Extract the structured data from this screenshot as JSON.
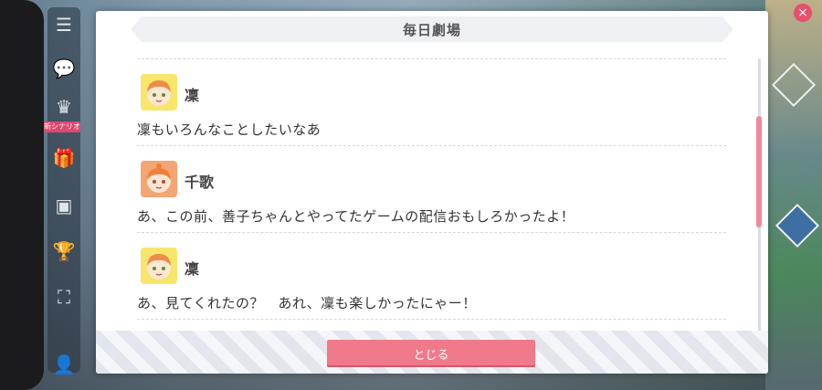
{
  "window": {
    "title": "毎日劇場"
  },
  "side_menu": {
    "tag_label": "新シナリオ",
    "items": [
      {
        "icon": "menu-icon"
      },
      {
        "icon": "chat-icon"
      },
      {
        "icon": "crown-icon"
      },
      {
        "icon": "gift-icon"
      },
      {
        "icon": "screen-icon"
      },
      {
        "icon": "trophy-icon"
      },
      {
        "icon": "fullscreen-icon"
      }
    ]
  },
  "entries": [
    {
      "speaker": "凜",
      "text": "凜もいろんなことしたいなあ",
      "avatar_color": "#f7e66b",
      "hair_color": "#ee8a4a"
    },
    {
      "speaker": "千歌",
      "text": "あ、この前、善子ちゃんとやってたゲームの配信おもしろかったよ！",
      "avatar_color": "#f4a574",
      "hair_color": "#ef7f3a"
    },
    {
      "speaker": "凜",
      "text": "あ、見てくれたの？　あれ、凜も楽しかったにゃー！",
      "avatar_color": "#f7e66b",
      "hair_color": "#ee8a4a"
    }
  ],
  "footer": {
    "close_label": "とじる"
  },
  "colors": {
    "accent": "#f07a8b",
    "scroll_thumb": "#f08a9a"
  }
}
